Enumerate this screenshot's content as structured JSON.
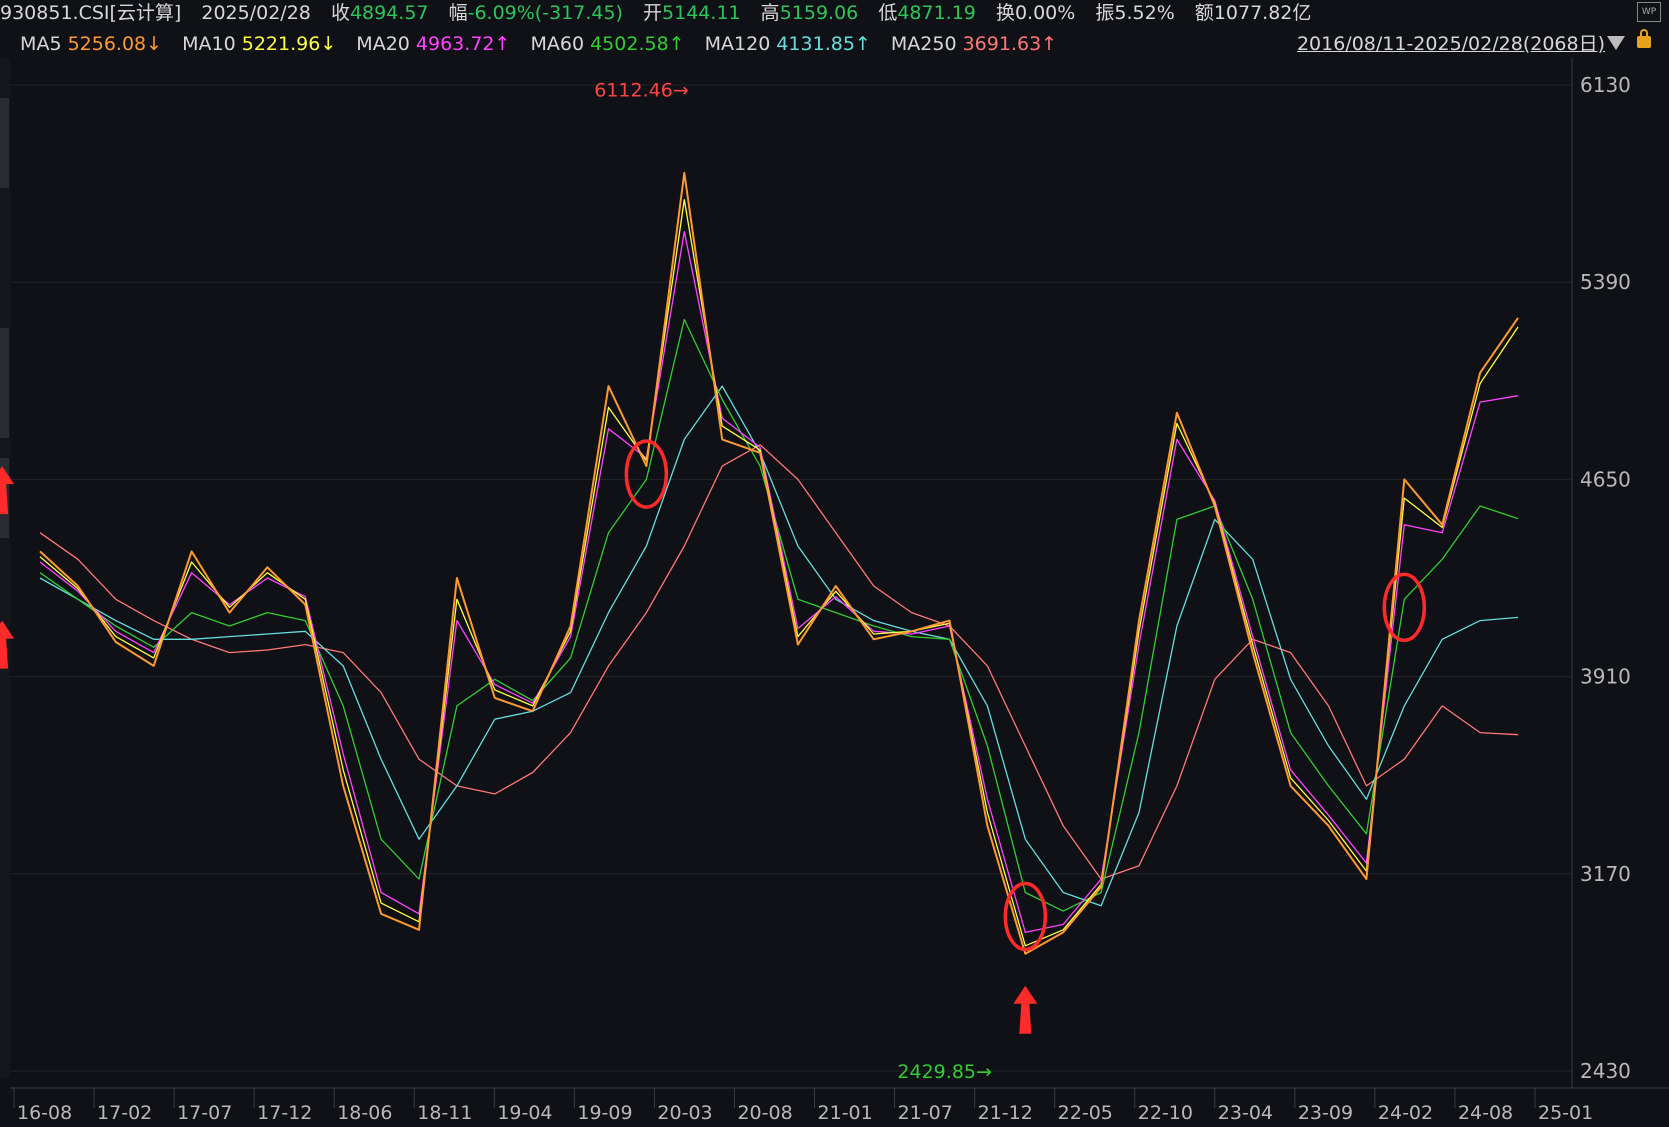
{
  "quote": {
    "code": "930851.CSI[云计算]",
    "date": "2025/02/28",
    "close_label": "收",
    "close": "4894.57",
    "change_label": "幅",
    "change": "-6.09%(-317.45)",
    "open_label": "开",
    "open": "5144.11",
    "high_label": "高",
    "high": "5159.06",
    "low_label": "低",
    "low": "4871.19",
    "turnover_label": "换",
    "turnover": "0.00%",
    "amplitude_label": "振",
    "amplitude": "5.52%",
    "amount_label": "额",
    "amount": "1077.82亿"
  },
  "ma": [
    {
      "name": "MA5",
      "value": "5256.08↓",
      "color": "#ff9933"
    },
    {
      "name": "MA10",
      "value": "5221.96↓",
      "color": "#ffff44"
    },
    {
      "name": "MA20",
      "value": "4963.72↑",
      "color": "#ff44ff"
    },
    {
      "name": "MA60",
      "value": "4502.58↑",
      "color": "#33cc33"
    },
    {
      "name": "MA120",
      "value": "4131.85↑",
      "color": "#66dddd"
    },
    {
      "name": "MA250",
      "value": "3691.63↑",
      "color": "#ff7777"
    }
  ],
  "range": "2016/08/11-2025/02/28(2068日)",
  "icons": {
    "lock": "lock-icon",
    "wp": "wp-icon",
    "dropdown": "triangle-down-icon"
  },
  "wp_text": "WP",
  "chart_data": {
    "type": "line",
    "title": "",
    "xlabel": "",
    "ylabel": "",
    "ylim": [
      2430,
      6130
    ],
    "yticks": [
      "6130",
      "5390",
      "4650",
      "3910",
      "3170",
      "2430"
    ],
    "ytick_values": [
      6130,
      5390,
      4650,
      3910,
      3170,
      2430
    ],
    "xticks": [
      "16-08",
      "17-02",
      "17-07",
      "17-12",
      "18-06",
      "18-11",
      "19-04",
      "19-09",
      "20-03",
      "20-08",
      "21-01",
      "21-07",
      "21-12",
      "22-05",
      "22-10",
      "23-04",
      "23-09",
      "24-02",
      "24-08",
      "25-01"
    ],
    "grid": true,
    "x": [
      "16-08",
      "16-11",
      "17-02",
      "17-04",
      "17-07",
      "17-09",
      "17-12",
      "18-03",
      "18-06",
      "18-09",
      "18-11",
      "19-02",
      "19-04",
      "19-07",
      "19-09",
      "19-12",
      "20-03",
      "20-05",
      "20-08",
      "20-11",
      "21-01",
      "21-04",
      "21-07",
      "21-10",
      "21-12",
      "22-03",
      "22-05",
      "22-08",
      "22-10",
      "23-01",
      "23-04",
      "23-07",
      "23-09",
      "23-12",
      "24-02",
      "24-05",
      "24-08",
      "24-11",
      "25-01",
      "25-02"
    ],
    "series": [
      {
        "name": "MA5",
        "color": "#ff9933",
        "values": [
          4380,
          4250,
          4040,
          3950,
          4380,
          4150,
          4320,
          4180,
          3500,
          3020,
          2960,
          4280,
          3830,
          3780,
          4100,
          5000,
          4700,
          5800,
          4800,
          4750,
          4030,
          4250,
          4050,
          4080,
          4120,
          3350,
          2870,
          2950,
          3120,
          4120,
          4900,
          4550,
          4000,
          3500,
          3350,
          3150,
          4650,
          4480,
          5050,
          5256
        ]
      },
      {
        "name": "MA10",
        "color": "#ffff44",
        "values": [
          4360,
          4240,
          4060,
          3980,
          4340,
          4170,
          4300,
          4200,
          3560,
          3060,
          2990,
          4200,
          3860,
          3800,
          4080,
          4920,
          4720,
          5700,
          4850,
          4760,
          4060,
          4230,
          4070,
          4080,
          4110,
          3400,
          2900,
          2960,
          3130,
          4080,
          4860,
          4560,
          4030,
          3530,
          3370,
          3180,
          4580,
          4470,
          5010,
          5222
        ]
      },
      {
        "name": "MA20",
        "color": "#ff44ff",
        "values": [
          4340,
          4230,
          4080,
          4000,
          4300,
          4180,
          4280,
          4210,
          3620,
          3100,
          3020,
          4120,
          3880,
          3810,
          4060,
          4840,
          4730,
          5580,
          4880,
          4770,
          4090,
          4210,
          4080,
          4070,
          4100,
          3450,
          2950,
          2980,
          3150,
          4030,
          4800,
          4570,
          4060,
          3560,
          3390,
          3210,
          4480,
          4450,
          4940,
          4964
        ]
      },
      {
        "name": "MA60",
        "color": "#33cc33",
        "values": [
          4300,
          4200,
          4100,
          4020,
          4150,
          4100,
          4150,
          4120,
          3800,
          3300,
          3150,
          3800,
          3900,
          3820,
          3980,
          4450,
          4650,
          5250,
          4950,
          4700,
          4200,
          4150,
          4100,
          4060,
          4050,
          3650,
          3100,
          3030,
          3100,
          3700,
          4500,
          4550,
          4200,
          3700,
          3500,
          3320,
          4200,
          4350,
          4550,
          4503
        ]
      },
      {
        "name": "MA120",
        "color": "#66dddd",
        "values": [
          4280,
          4200,
          4120,
          4050,
          4050,
          4060,
          4070,
          4080,
          3950,
          3600,
          3300,
          3500,
          3750,
          3780,
          3850,
          4150,
          4400,
          4800,
          5000,
          4750,
          4400,
          4200,
          4120,
          4080,
          4050,
          3800,
          3300,
          3100,
          3050,
          3400,
          4100,
          4500,
          4350,
          3900,
          3650,
          3450,
          3800,
          4050,
          4120,
          4132
        ]
      },
      {
        "name": "MA250",
        "color": "#ff7777",
        "values": [
          4450,
          4350,
          4200,
          4120,
          4050,
          4000,
          4010,
          4030,
          4000,
          3850,
          3600,
          3500,
          3470,
          3550,
          3700,
          3950,
          4150,
          4400,
          4700,
          4780,
          4650,
          4450,
          4250,
          4150,
          4100,
          3950,
          3650,
          3350,
          3150,
          3200,
          3500,
          3900,
          4050,
          4000,
          3800,
          3500,
          3600,
          3800,
          3700,
          3692
        ]
      }
    ],
    "annotations": [
      {
        "text": "6112.46→",
        "x": "20-05",
        "y": 6112.46,
        "color": "#ff4444"
      },
      {
        "text": "2429.85→",
        "x": "22-03",
        "y": 2429.85,
        "color": "#33cc33"
      }
    ],
    "markers": [
      {
        "type": "circle",
        "x": "20-03",
        "y": 4670
      },
      {
        "type": "circle",
        "x": "22-05",
        "y": 3010
      },
      {
        "type": "circle",
        "x": "24-08",
        "y": 4170
      },
      {
        "type": "arrow",
        "x": "19-11",
        "y": 4670
      },
      {
        "type": "arrow",
        "x": "22-05",
        "y": 2720
      },
      {
        "type": "arrow",
        "x": "24-06",
        "y": 4090
      }
    ]
  }
}
